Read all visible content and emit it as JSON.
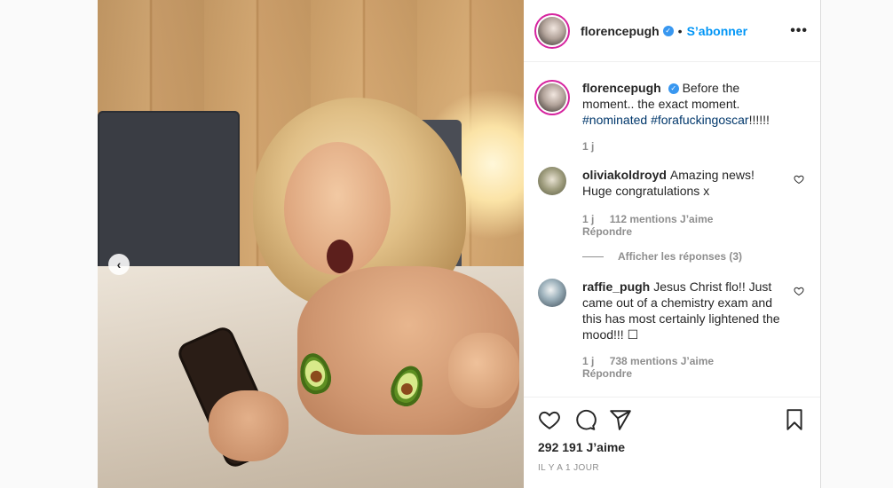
{
  "post": {
    "username": "florencepugh",
    "follow_label": "S’abonner",
    "dot": "•",
    "caption_text": "Before the moment.. the exact moment.",
    "hashtags": [
      "#nominated",
      "#forafuckingoscar"
    ],
    "caption_suffix": "!!!!!!",
    "caption_time": "1 j",
    "likes": "292 191 J’aime",
    "posted": "IL Y A 1 JOUR"
  },
  "comments": [
    {
      "username": "oliviakoldroyd",
      "text": "Amazing news! Huge congratulations x",
      "time": "1 j",
      "likes": "112 mentions J’aime",
      "reply_label": "Répondre",
      "view_replies": "Afficher les réponses (3)"
    },
    {
      "username": "raffie_pugh",
      "text": "Jesus Christ flo!! Just came out of a chemistry exam and this has most certainly lightened the mood!!! ☐",
      "time": "1 j",
      "likes": "738 mentions J’aime",
      "reply_label": "Répondre"
    }
  ],
  "icons": {
    "more": "more-options-icon",
    "verified": "verified-badge-icon",
    "heart": "heart-icon",
    "comment": "comment-icon",
    "share": "share-icon",
    "save": "bookmark-icon",
    "prev": "chevron-left-icon"
  },
  "colors": {
    "accent": "#0095f6",
    "verified": "#3897f0",
    "muted": "#8e8e8e",
    "hashtag": "#00376b"
  }
}
